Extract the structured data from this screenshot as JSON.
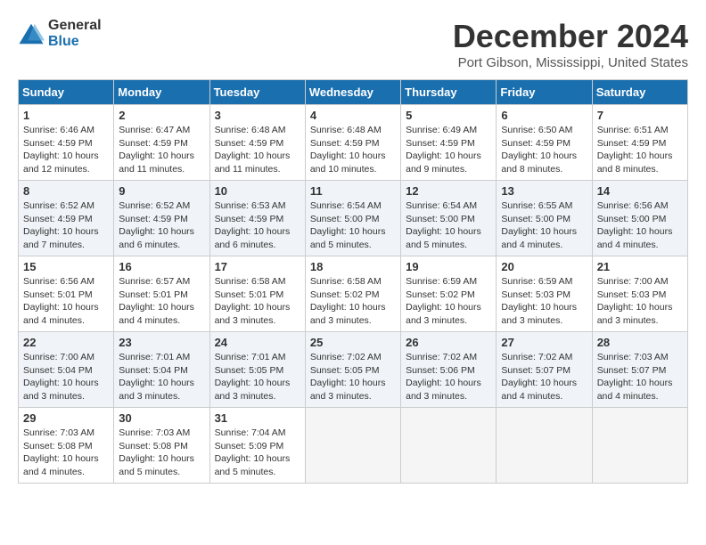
{
  "logo": {
    "general": "General",
    "blue": "Blue"
  },
  "header": {
    "title": "December 2024",
    "location": "Port Gibson, Mississippi, United States"
  },
  "days_of_week": [
    "Sunday",
    "Monday",
    "Tuesday",
    "Wednesday",
    "Thursday",
    "Friday",
    "Saturday"
  ],
  "weeks": [
    [
      {
        "num": "1",
        "info": "Sunrise: 6:46 AM\nSunset: 4:59 PM\nDaylight: 10 hours\nand 12 minutes."
      },
      {
        "num": "2",
        "info": "Sunrise: 6:47 AM\nSunset: 4:59 PM\nDaylight: 10 hours\nand 11 minutes."
      },
      {
        "num": "3",
        "info": "Sunrise: 6:48 AM\nSunset: 4:59 PM\nDaylight: 10 hours\nand 11 minutes."
      },
      {
        "num": "4",
        "info": "Sunrise: 6:48 AM\nSunset: 4:59 PM\nDaylight: 10 hours\nand 10 minutes."
      },
      {
        "num": "5",
        "info": "Sunrise: 6:49 AM\nSunset: 4:59 PM\nDaylight: 10 hours\nand 9 minutes."
      },
      {
        "num": "6",
        "info": "Sunrise: 6:50 AM\nSunset: 4:59 PM\nDaylight: 10 hours\nand 8 minutes."
      },
      {
        "num": "7",
        "info": "Sunrise: 6:51 AM\nSunset: 4:59 PM\nDaylight: 10 hours\nand 8 minutes."
      }
    ],
    [
      {
        "num": "8",
        "info": "Sunrise: 6:52 AM\nSunset: 4:59 PM\nDaylight: 10 hours\nand 7 minutes."
      },
      {
        "num": "9",
        "info": "Sunrise: 6:52 AM\nSunset: 4:59 PM\nDaylight: 10 hours\nand 6 minutes."
      },
      {
        "num": "10",
        "info": "Sunrise: 6:53 AM\nSunset: 4:59 PM\nDaylight: 10 hours\nand 6 minutes."
      },
      {
        "num": "11",
        "info": "Sunrise: 6:54 AM\nSunset: 5:00 PM\nDaylight: 10 hours\nand 5 minutes."
      },
      {
        "num": "12",
        "info": "Sunrise: 6:54 AM\nSunset: 5:00 PM\nDaylight: 10 hours\nand 5 minutes."
      },
      {
        "num": "13",
        "info": "Sunrise: 6:55 AM\nSunset: 5:00 PM\nDaylight: 10 hours\nand 4 minutes."
      },
      {
        "num": "14",
        "info": "Sunrise: 6:56 AM\nSunset: 5:00 PM\nDaylight: 10 hours\nand 4 minutes."
      }
    ],
    [
      {
        "num": "15",
        "info": "Sunrise: 6:56 AM\nSunset: 5:01 PM\nDaylight: 10 hours\nand 4 minutes."
      },
      {
        "num": "16",
        "info": "Sunrise: 6:57 AM\nSunset: 5:01 PM\nDaylight: 10 hours\nand 4 minutes."
      },
      {
        "num": "17",
        "info": "Sunrise: 6:58 AM\nSunset: 5:01 PM\nDaylight: 10 hours\nand 3 minutes."
      },
      {
        "num": "18",
        "info": "Sunrise: 6:58 AM\nSunset: 5:02 PM\nDaylight: 10 hours\nand 3 minutes."
      },
      {
        "num": "19",
        "info": "Sunrise: 6:59 AM\nSunset: 5:02 PM\nDaylight: 10 hours\nand 3 minutes."
      },
      {
        "num": "20",
        "info": "Sunrise: 6:59 AM\nSunset: 5:03 PM\nDaylight: 10 hours\nand 3 minutes."
      },
      {
        "num": "21",
        "info": "Sunrise: 7:00 AM\nSunset: 5:03 PM\nDaylight: 10 hours\nand 3 minutes."
      }
    ],
    [
      {
        "num": "22",
        "info": "Sunrise: 7:00 AM\nSunset: 5:04 PM\nDaylight: 10 hours\nand 3 minutes."
      },
      {
        "num": "23",
        "info": "Sunrise: 7:01 AM\nSunset: 5:04 PM\nDaylight: 10 hours\nand 3 minutes."
      },
      {
        "num": "24",
        "info": "Sunrise: 7:01 AM\nSunset: 5:05 PM\nDaylight: 10 hours\nand 3 minutes."
      },
      {
        "num": "25",
        "info": "Sunrise: 7:02 AM\nSunset: 5:05 PM\nDaylight: 10 hours\nand 3 minutes."
      },
      {
        "num": "26",
        "info": "Sunrise: 7:02 AM\nSunset: 5:06 PM\nDaylight: 10 hours\nand 3 minutes."
      },
      {
        "num": "27",
        "info": "Sunrise: 7:02 AM\nSunset: 5:07 PM\nDaylight: 10 hours\nand 4 minutes."
      },
      {
        "num": "28",
        "info": "Sunrise: 7:03 AM\nSunset: 5:07 PM\nDaylight: 10 hours\nand 4 minutes."
      }
    ],
    [
      {
        "num": "29",
        "info": "Sunrise: 7:03 AM\nSunset: 5:08 PM\nDaylight: 10 hours\nand 4 minutes."
      },
      {
        "num": "30",
        "info": "Sunrise: 7:03 AM\nSunset: 5:08 PM\nDaylight: 10 hours\nand 5 minutes."
      },
      {
        "num": "31",
        "info": "Sunrise: 7:04 AM\nSunset: 5:09 PM\nDaylight: 10 hours\nand 5 minutes."
      },
      {
        "num": "",
        "info": ""
      },
      {
        "num": "",
        "info": ""
      },
      {
        "num": "",
        "info": ""
      },
      {
        "num": "",
        "info": ""
      }
    ]
  ]
}
